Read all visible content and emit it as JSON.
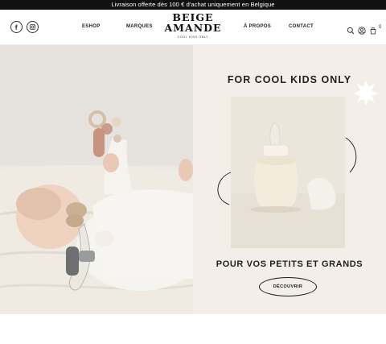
{
  "announcement": {
    "text": "Livraison offerte dès 100 € d'achat uniquement en Belgique"
  },
  "header": {
    "logo": {
      "line1": "BEIGE",
      "line2": "AMANDE",
      "tagline": "COOL KIDS ONLY"
    },
    "nav": {
      "eshop": "ESHOP",
      "marques": "MARQUES",
      "apropos": "À PROPOS",
      "contact": "CONTACT"
    },
    "cart_count": "0",
    "icons": [
      "facebook-icon",
      "instagram-icon",
      "search-icon",
      "account-icon",
      "cart-icon"
    ]
  },
  "hero": {
    "title": "FOR COOL KIDS ONLY",
    "subtitle": "POUR VOS PETITS ET GRANDS",
    "cta": "DÉCOUVRIR"
  },
  "colors": {
    "announcement_bg": "#111111",
    "panel_bg": "#f3efe8",
    "text": "#1a1a1a"
  }
}
